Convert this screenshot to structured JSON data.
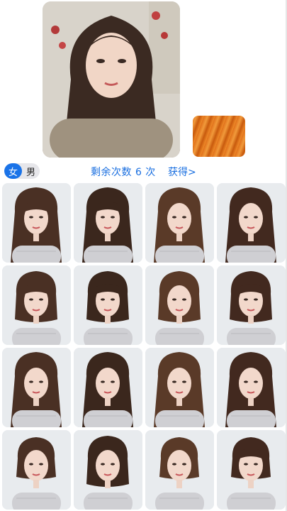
{
  "gender": {
    "options": [
      "女",
      "男"
    ],
    "selected": "女"
  },
  "quota": {
    "text": "剩余次数 6 次",
    "action": "获得>"
  },
  "colors": {
    "accent": "#1a73e8",
    "selected_hair_color": "#e8801f"
  },
  "styles": [
    {
      "hair": "long-straight-bangs"
    },
    {
      "hair": "long-wavy-bangs"
    },
    {
      "hair": "long-wavy"
    },
    {
      "hair": "long-wavy-side"
    },
    {
      "hair": "bob-bangs"
    },
    {
      "hair": "bob-bangs"
    },
    {
      "hair": "bob-layered"
    },
    {
      "hair": "shoulder-bangs"
    },
    {
      "hair": "medium-curly"
    },
    {
      "hair": "long-curly"
    },
    {
      "hair": "long-wavy"
    },
    {
      "hair": "long-curly-center"
    },
    {
      "hair": "short-wavy"
    },
    {
      "hair": "bob-round"
    },
    {
      "hair": "short-curly"
    },
    {
      "hair": "short-bob-bangs"
    }
  ]
}
